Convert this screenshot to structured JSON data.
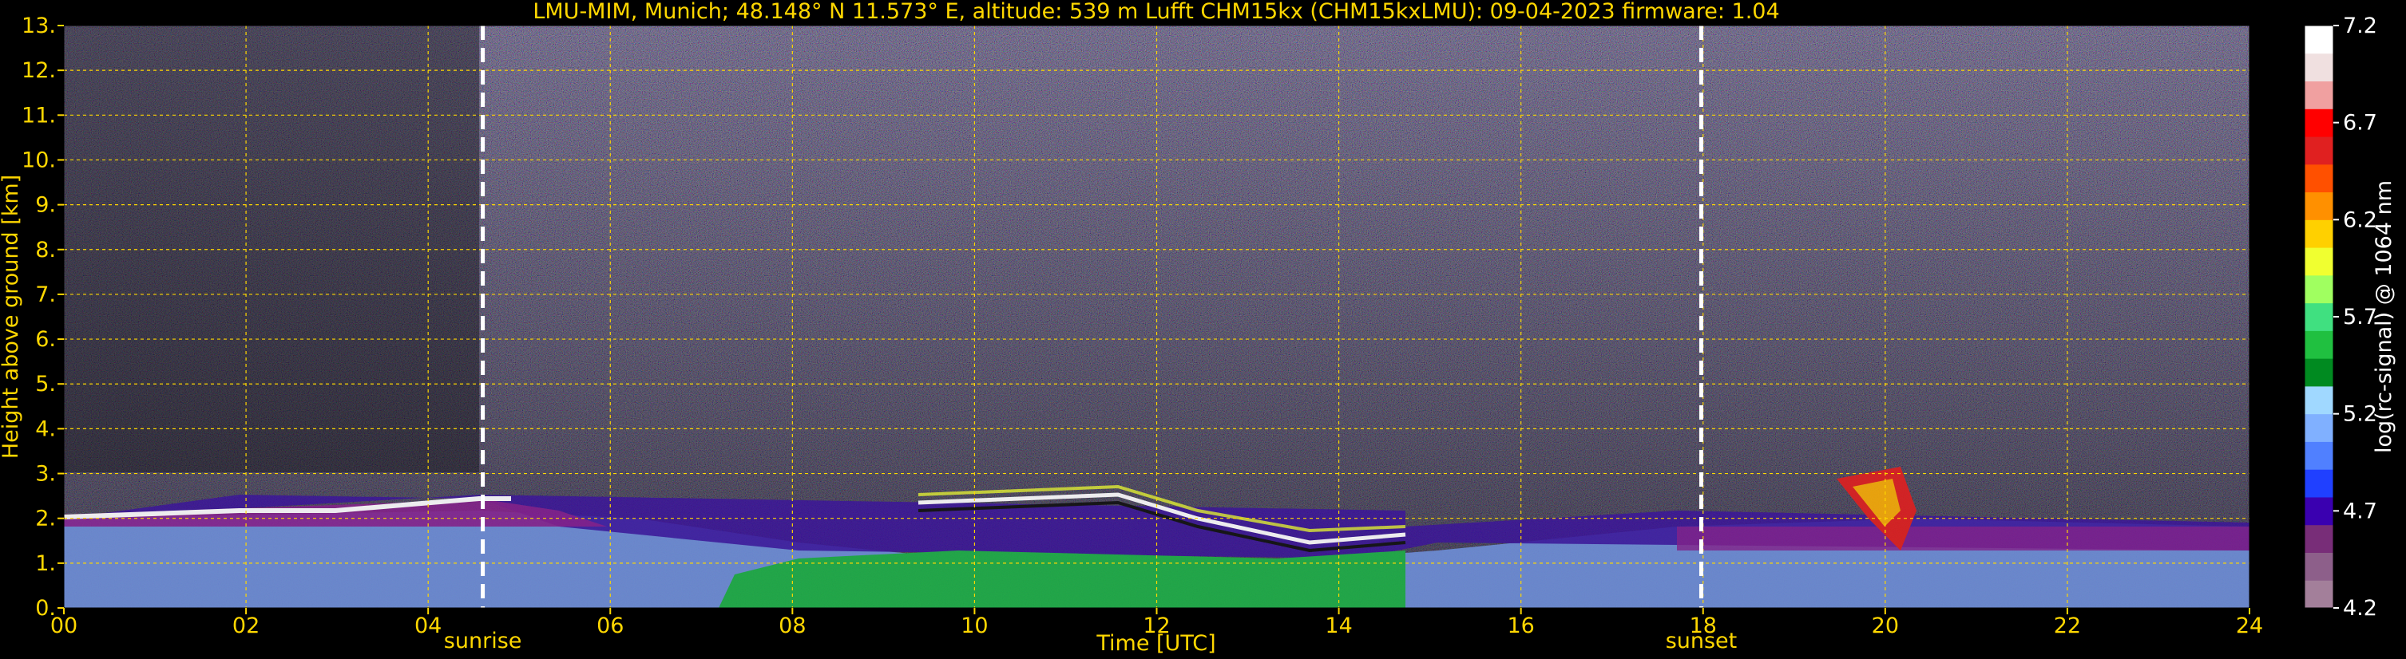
{
  "chart_data": {
    "type": "heatmap",
    "title": "LMU-MIM, Munich; 48.148° N 11.573° E, altitude: 539 m    Lufft CHM15kx (CHM15kxLMU): 09-04-2023    firmware: 1.04",
    "xlabel": "Time [UTC]",
    "ylabel": "Height above ground [km]",
    "xlim": [
      0,
      24
    ],
    "ylim": [
      0,
      13
    ],
    "x_ticks": [
      "00",
      "02",
      "04",
      "06",
      "08",
      "10",
      "12",
      "14",
      "16",
      "18",
      "20",
      "22",
      "24"
    ],
    "y_ticks": [
      "0.",
      "1.",
      "2.",
      "3.",
      "4.",
      "5.",
      "6.",
      "7.",
      "8.",
      "9.",
      "10.",
      "11.",
      "12.",
      "13."
    ],
    "grid": true,
    "markers": [
      {
        "label": "sunrise",
        "x": 4.6
      },
      {
        "label": "sunset",
        "x": 17.98
      }
    ],
    "colorbar": {
      "label": "log(rc-signal) @ 1064 nm",
      "range": [
        4.2,
        7.2
      ],
      "ticks": [
        "4.2",
        "4.7",
        "5.2",
        "5.7",
        "6.2",
        "6.7",
        "7.2"
      ],
      "colors": [
        "#a37f9a",
        "#8d5f8a",
        "#782d78",
        "#3a00b0",
        "#2040ff",
        "#5080ff",
        "#80b0ff",
        "#a0d8ff",
        "#008a20",
        "#20c040",
        "#40e080",
        "#a0ff60",
        "#f0ff30",
        "#ffd000",
        "#ff9000",
        "#ff5000",
        "#e02020",
        "#ff0000",
        "#f0a0a0",
        "#f0e0e0",
        "#ffffff"
      ]
    }
  }
}
